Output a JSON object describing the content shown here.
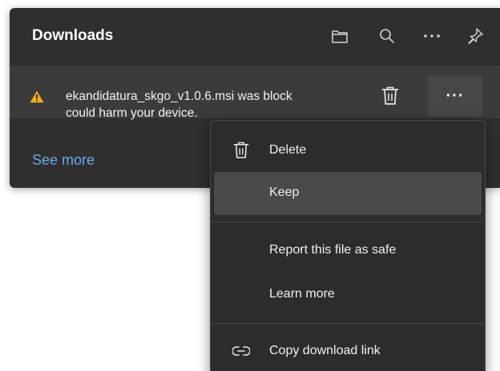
{
  "downloads": {
    "title": "Downloads",
    "header_icons": [
      "folder-icon",
      "search-icon",
      "more-options-icon",
      "pin-icon"
    ],
    "item": {
      "warning_icon": "warning-icon",
      "message_line1": "ekandidatura_skgo_v1.0.6.msi was block",
      "message_line2": "could harm your device.",
      "more_label": "···"
    },
    "see_more": "See more"
  },
  "menu": {
    "items": [
      {
        "label": "Delete",
        "icon": "trash-icon"
      },
      {
        "label": "Keep",
        "icon": ""
      },
      {
        "label": "Report this file as safe",
        "icon": ""
      },
      {
        "label": "Learn more",
        "icon": ""
      },
      {
        "label": "Copy download link",
        "icon": "link-icon"
      }
    ]
  },
  "colors": {
    "panel": "#2f2f2f",
    "item_bg": "#3b3b3b",
    "menu_bg": "#2c2c2c",
    "highlight": "#494949",
    "link": "#6aa9e8",
    "warning": "#f2b01e"
  }
}
